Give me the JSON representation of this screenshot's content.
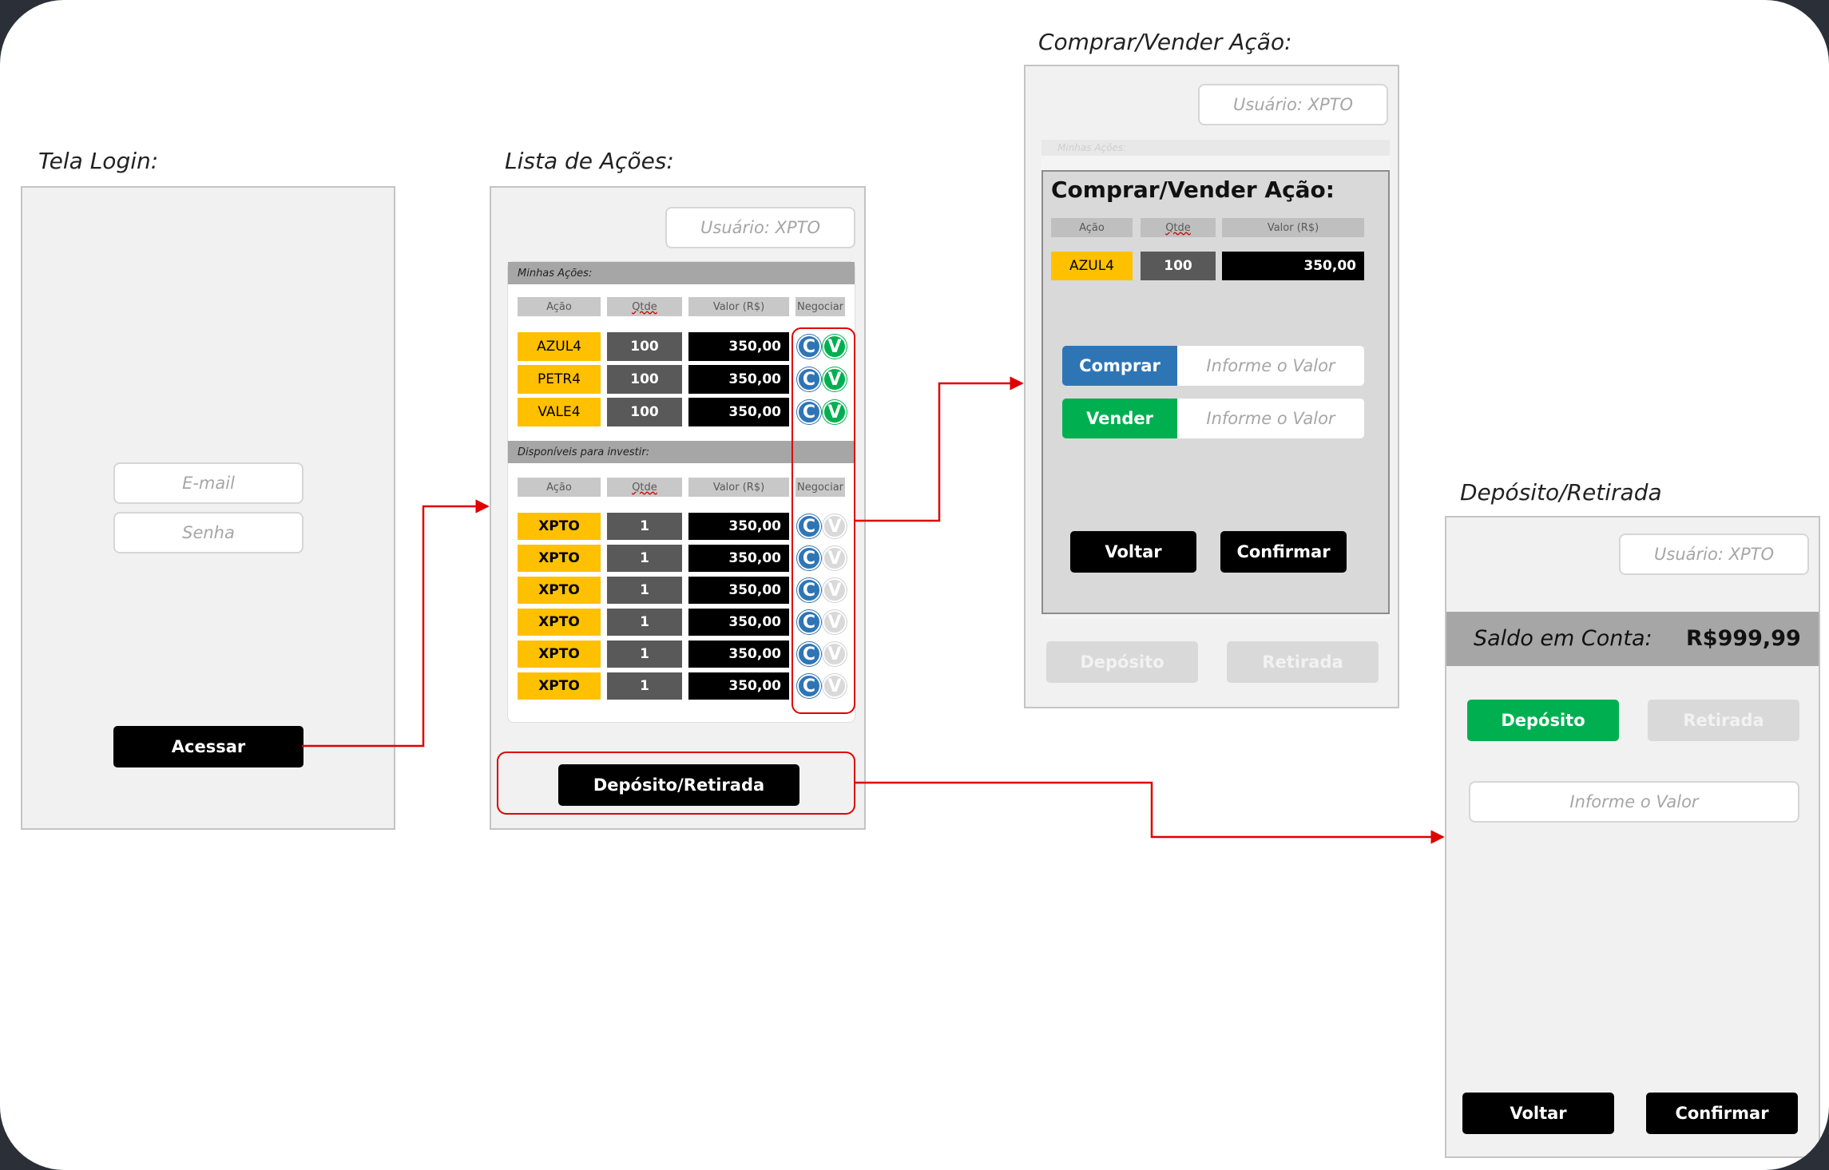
{
  "login": {
    "title": "Tela Login:",
    "email_placeholder": "E-mail",
    "password_placeholder": "Senha",
    "access_button": "Acessar"
  },
  "list": {
    "title": "Lista de Ações:",
    "user": "Usuário: XPTO",
    "my_section": "Minhas Ações:",
    "available_section": "Disponíveis para investir:",
    "headers": [
      "Ação",
      "Qtde",
      "Valor (R$)",
      "Negociar"
    ],
    "my_rows": [
      {
        "ticker": "AZUL4",
        "qty": "100",
        "value": "350,00"
      },
      {
        "ticker": "PETR4",
        "qty": "100",
        "value": "350,00"
      },
      {
        "ticker": "VALE4",
        "qty": "100",
        "value": "350,00"
      }
    ],
    "available_rows": [
      {
        "ticker": "XPTO",
        "qty": "1",
        "value": "350,00"
      },
      {
        "ticker": "XPTO",
        "qty": "1",
        "value": "350,00"
      },
      {
        "ticker": "XPTO",
        "qty": "1",
        "value": "350,00"
      },
      {
        "ticker": "XPTO",
        "qty": "1",
        "value": "350,00"
      },
      {
        "ticker": "XPTO",
        "qty": "1",
        "value": "350,00"
      },
      {
        "ticker": "XPTO",
        "qty": "1",
        "value": "350,00"
      }
    ],
    "buy_glyph": "C",
    "sell_glyph": "V",
    "deposit_withdraw_button": "Depósito/Retirada"
  },
  "trade": {
    "title": "Comprar/Vender Ação:",
    "user": "Usuário: XPTO",
    "bg_section": "Minhas Ações:",
    "modal_title": "Comprar/Vender Ação:",
    "headers": [
      "Ação",
      "Qtde",
      "Valor (R$)"
    ],
    "row": {
      "ticker": "AZUL4",
      "qty": "100",
      "value": "350,00"
    },
    "buy_button": "Comprar",
    "sell_button": "Vender",
    "value_placeholder": "Informe o Valor",
    "back_button": "Voltar",
    "confirm_button": "Confirmar",
    "bg_deposit": "Depósito",
    "bg_withdraw": "Retirada"
  },
  "deposit": {
    "title": "Depósito/Retirada",
    "user": "Usuário: XPTO",
    "balance_label": "Saldo em Conta:",
    "balance_value": "R$999,99",
    "deposit_button": "Depósito",
    "withdraw_button": "Retirada",
    "value_placeholder": "Informe o Valor",
    "back_button": "Voltar",
    "confirm_button": "Confirmar"
  },
  "colors": {
    "arrow": "#e00000",
    "ticker": "#ffc000",
    "buy": "#2e75b6",
    "sell": "#00b050"
  }
}
